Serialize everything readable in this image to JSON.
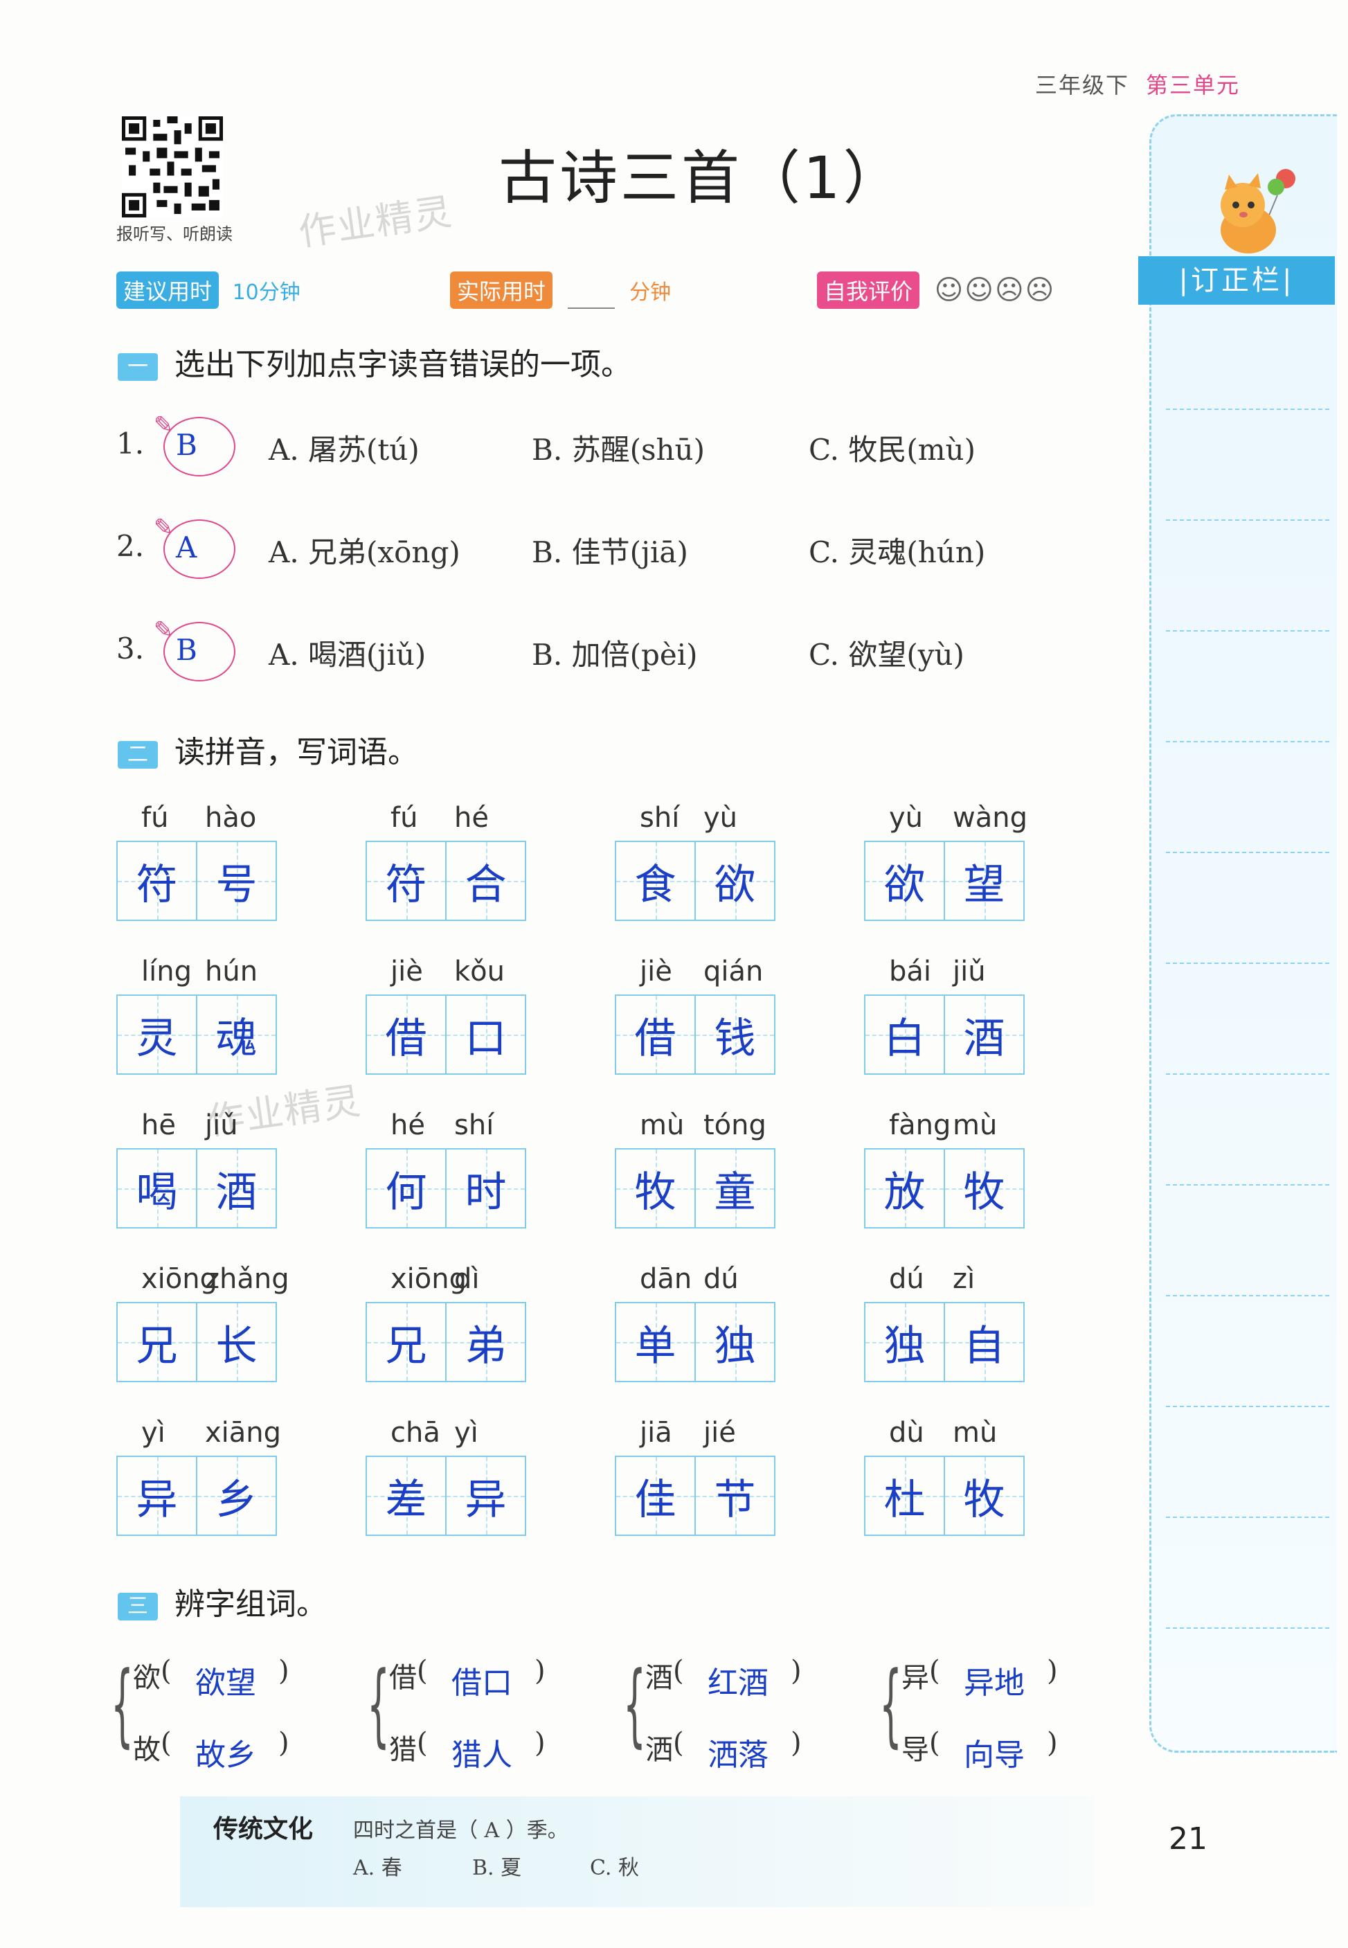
{
  "header": {
    "grade": "三年级下",
    "unit": "第三单元",
    "title": "古诗三首（1）",
    "qr_caption": "报听写、听朗读",
    "watermark": "作业精灵"
  },
  "time_row": {
    "suggest_label": "建议用时",
    "suggest_value": "10分钟",
    "actual_label": "实际用时",
    "actual_unit": "分钟",
    "eval_label": "自我评价",
    "faces": "☺☺☹☹"
  },
  "section1": {
    "num": "一",
    "title": "选出下列加点字读音错误的一项。",
    "questions": [
      {
        "n": "1.",
        "answer": "B",
        "a": "A. 屠苏(tú)",
        "b": "B. 苏醒(shū)",
        "c": "C. 牧民(mù)"
      },
      {
        "n": "2.",
        "answer": "A",
        "a": "A. 兄弟(xōng)",
        "b": "B. 佳节(jiā)",
        "c": "C. 灵魂(hún)"
      },
      {
        "n": "3.",
        "answer": "B",
        "a": "A. 喝酒(jiǔ)",
        "b": "B. 加倍(pèi)",
        "c": "C. 欲望(yù)"
      }
    ]
  },
  "section2": {
    "num": "二",
    "title": "读拼音，写词语。",
    "rows": [
      [
        {
          "p1": "fú",
          "p2": "hào",
          "c1": "符",
          "c2": "号"
        },
        {
          "p1": "fú",
          "p2": "hé",
          "c1": "符",
          "c2": "合"
        },
        {
          "p1": "shí",
          "p2": "yù",
          "c1": "食",
          "c2": "欲"
        },
        {
          "p1": "yù",
          "p2": "wàng",
          "c1": "欲",
          "c2": "望"
        }
      ],
      [
        {
          "p1": "líng",
          "p2": "hún",
          "c1": "灵",
          "c2": "魂"
        },
        {
          "p1": "jiè",
          "p2": "kǒu",
          "c1": "借",
          "c2": "口"
        },
        {
          "p1": "jiè",
          "p2": "qián",
          "c1": "借",
          "c2": "钱"
        },
        {
          "p1": "bái",
          "p2": "jiǔ",
          "c1": "白",
          "c2": "酒"
        }
      ],
      [
        {
          "p1": "hē",
          "p2": "jiǔ",
          "c1": "喝",
          "c2": "酒"
        },
        {
          "p1": "hé",
          "p2": "shí",
          "c1": "何",
          "c2": "时"
        },
        {
          "p1": "mù",
          "p2": "tóng",
          "c1": "牧",
          "c2": "童"
        },
        {
          "p1": "fàng",
          "p2": "mù",
          "c1": "放",
          "c2": "牧"
        }
      ],
      [
        {
          "p1": "xiōng",
          "p2": "zhǎng",
          "c1": "兄",
          "c2": "长"
        },
        {
          "p1": "xiōng",
          "p2": "dì",
          "c1": "兄",
          "c2": "弟"
        },
        {
          "p1": "dān",
          "p2": "dú",
          "c1": "单",
          "c2": "独"
        },
        {
          "p1": "dú",
          "p2": "zì",
          "c1": "独",
          "c2": "自"
        }
      ],
      [
        {
          "p1": "yì",
          "p2": "xiāng",
          "c1": "异",
          "c2": "乡"
        },
        {
          "p1": "chā",
          "p2": "yì",
          "c1": "差",
          "c2": "异"
        },
        {
          "p1": "jiā",
          "p2": "jié",
          "c1": "佳",
          "c2": "节"
        },
        {
          "p1": "dù",
          "p2": "mù",
          "c1": "杜",
          "c2": "牧"
        }
      ]
    ]
  },
  "section3": {
    "num": "三",
    "title": "辨字组词。",
    "paren_open": "(",
    "paren_close": ")",
    "groups": [
      [
        {
          "ch": "欲",
          "ans": "欲望"
        },
        {
          "ch": "故",
          "ans": "故乡"
        }
      ],
      [
        {
          "ch": "借",
          "ans": "借口"
        },
        {
          "ch": "猎",
          "ans": "猎人"
        }
      ],
      [
        {
          "ch": "酒",
          "ans": "红酒"
        },
        {
          "ch": "洒",
          "ans": "洒落"
        }
      ],
      [
        {
          "ch": "异",
          "ans": "异地"
        },
        {
          "ch": "导",
          "ans": "向导"
        }
      ]
    ]
  },
  "footer": {
    "title": "传统文化",
    "question": "四时之首是（ A ）季。",
    "opt_a": "A. 春",
    "opt_b": "B. 夏",
    "opt_c": "C. 秋",
    "page": "21"
  },
  "correction": {
    "label": "|订正栏|"
  }
}
